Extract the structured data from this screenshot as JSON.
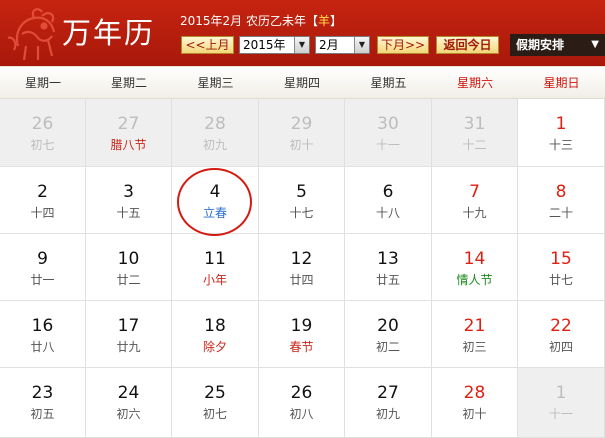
{
  "app_title": "万年历",
  "lunar_info": {
    "prefix": "2015年2月 农历乙未年【",
    "zodiac": "羊",
    "suffix": "】"
  },
  "controls": {
    "prev_month": "<<上月",
    "year_value": "2015年",
    "month_value": "2月",
    "next_month": "下月>>",
    "back_today": "返回今日",
    "holiday_arrangement": "假期安排"
  },
  "weekdays": [
    "星期一",
    "星期二",
    "星期三",
    "星期四",
    "星期五",
    "星期六",
    "星期日"
  ],
  "weeks": [
    [
      {
        "day": "26",
        "sub": "初七",
        "dim": true
      },
      {
        "day": "27",
        "sub": "腊八节",
        "dim": true,
        "subColor": "red"
      },
      {
        "day": "28",
        "sub": "初九",
        "dim": true
      },
      {
        "day": "29",
        "sub": "初十",
        "dim": true
      },
      {
        "day": "30",
        "sub": "十一",
        "dim": true
      },
      {
        "day": "31",
        "sub": "十二",
        "dim": true
      },
      {
        "day": "1",
        "sub": "十三",
        "dayColor": "red"
      }
    ],
    [
      {
        "day": "2",
        "sub": "十四"
      },
      {
        "day": "3",
        "sub": "十五"
      },
      {
        "day": "4",
        "sub": "立春",
        "subColor": "blue",
        "today": true
      },
      {
        "day": "5",
        "sub": "十七"
      },
      {
        "day": "6",
        "sub": "十八"
      },
      {
        "day": "7",
        "sub": "十九",
        "dayColor": "red"
      },
      {
        "day": "8",
        "sub": "二十",
        "dayColor": "red"
      }
    ],
    [
      {
        "day": "9",
        "sub": "廿一"
      },
      {
        "day": "10",
        "sub": "廿二"
      },
      {
        "day": "11",
        "sub": "小年",
        "subColor": "red"
      },
      {
        "day": "12",
        "sub": "廿四"
      },
      {
        "day": "13",
        "sub": "廿五"
      },
      {
        "day": "14",
        "sub": "情人节",
        "dayColor": "red",
        "subColor": "green"
      },
      {
        "day": "15",
        "sub": "廿七",
        "dayColor": "red"
      }
    ],
    [
      {
        "day": "16",
        "sub": "廿八"
      },
      {
        "day": "17",
        "sub": "廿九"
      },
      {
        "day": "18",
        "sub": "除夕",
        "subColor": "red"
      },
      {
        "day": "19",
        "sub": "春节",
        "subColor": "red"
      },
      {
        "day": "20",
        "sub": "初二"
      },
      {
        "day": "21",
        "sub": "初三",
        "dayColor": "red"
      },
      {
        "day": "22",
        "sub": "初四",
        "dayColor": "red"
      }
    ],
    [
      {
        "day": "23",
        "sub": "初五"
      },
      {
        "day": "24",
        "sub": "初六"
      },
      {
        "day": "25",
        "sub": "初七"
      },
      {
        "day": "26",
        "sub": "初八"
      },
      {
        "day": "27",
        "sub": "初九"
      },
      {
        "day": "28",
        "sub": "初十",
        "dayColor": "red"
      },
      {
        "day": "1",
        "sub": "十一",
        "dim": true
      }
    ]
  ]
}
